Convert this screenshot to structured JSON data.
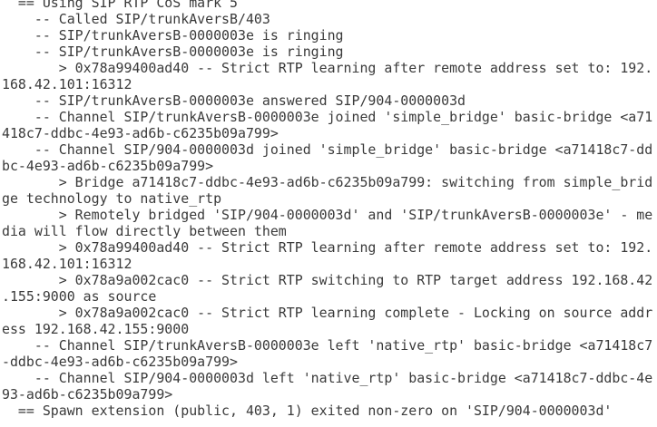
{
  "terminal": {
    "lines": [
      "  == Using SIP RTP CoS mark 5",
      "    -- Called SIP/trunkAversB/403",
      "    -- SIP/trunkAversB-0000003e is ringing",
      "    -- SIP/trunkAversB-0000003e is ringing",
      "       > 0x78a99400ad40 -- Strict RTP learning after remote address set to: 192.",
      "168.42.101:16312",
      "    -- SIP/trunkAversB-0000003e answered SIP/904-0000003d",
      "    -- Channel SIP/trunkAversB-0000003e joined 'simple_bridge' basic-bridge <a71",
      "418c7-ddbc-4e93-ad6b-c6235b09a799>",
      "    -- Channel SIP/904-0000003d joined 'simple_bridge' basic-bridge <a71418c7-dd",
      "bc-4e93-ad6b-c6235b09a799>",
      "       > Bridge a71418c7-ddbc-4e93-ad6b-c6235b09a799: switching from simple_brid",
      "ge technology to native_rtp",
      "       > Remotely bridged 'SIP/904-0000003d' and 'SIP/trunkAversB-0000003e' - me",
      "dia will flow directly between them",
      "       > 0x78a99400ad40 -- Strict RTP learning after remote address set to: 192.",
      "168.42.101:16312",
      "       > 0x78a9a002cac0 -- Strict RTP switching to RTP target address 192.168.42",
      ".155:9000 as source",
      "       > 0x78a9a002cac0 -- Strict RTP learning complete - Locking on source addr",
      "ess 192.168.42.155:9000",
      "    -- Channel SIP/trunkAversB-0000003e left 'native_rtp' basic-bridge <a71418c7",
      "-ddbc-4e93-ad6b-c6235b09a799>",
      "    -- Channel SIP/904-0000003d left 'native_rtp' basic-bridge <a71418c7-ddbc-4e",
      "93-ad6b-c6235b09a799>",
      "  == Spawn extension (public, 403, 1) exited non-zero on 'SIP/904-0000003d'"
    ]
  }
}
